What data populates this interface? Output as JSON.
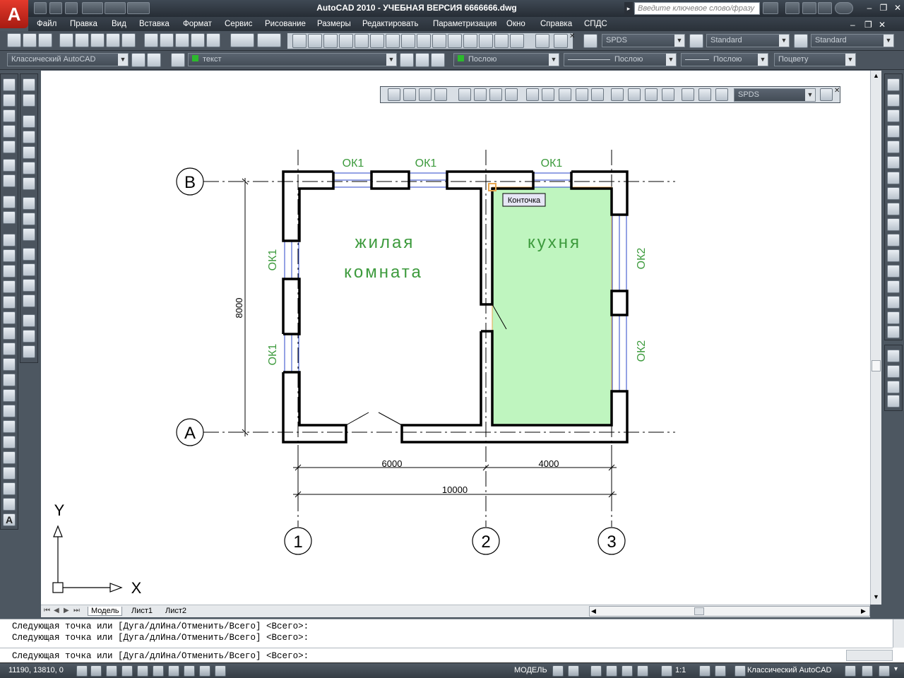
{
  "app": {
    "logo_letter": "A",
    "title": "AutoCAD 2010 - УЧЕБНАЯ ВЕРСИЯ     6666666.dwg",
    "search_placeholder": "Введите ключевое слово/фразу"
  },
  "menu": [
    "Файл",
    "Правка",
    "Вид",
    "Вставка",
    "Формат",
    "Сервис",
    "Рисование",
    "Размеры",
    "Редактировать",
    "Параметризация",
    "Окно",
    "Справка",
    "СПДС"
  ],
  "toolbars": {
    "workspace": "Классический AutoCAD",
    "layer": "текст",
    "color": "Послою",
    "linetype": "Послою",
    "lineweight": "Послою",
    "plotstyle": "Поцвету",
    "spds_style": "SPDS",
    "text_style": "Standard",
    "dim_style": "Standard",
    "floating_style": "SPDS"
  },
  "drawing": {
    "axes_rows": [
      "В",
      "А"
    ],
    "axes_cols": [
      "1",
      "2",
      "3"
    ],
    "windows": [
      "ОК1",
      "ОК1",
      "ОК1",
      "ОК1",
      "ОК1",
      "ОК2",
      "ОК2"
    ],
    "room1_line1": "жилая",
    "room1_line2": "комната",
    "room2": "кухня",
    "dim_left": "8000",
    "dim_6000": "6000",
    "dim_4000": "4000",
    "dim_total": "10000",
    "tooltip": "Конточка",
    "ucs_x": "X",
    "ucs_y": "Y"
  },
  "tabs": [
    "Модель",
    "Лист1",
    "Лист2"
  ],
  "command": {
    "line1": "Следующая точка или [Дуга/длИна/Отменить/Всего] <Всего>:",
    "line2": "Следующая точка или [Дуга/длИна/Отменить/Всего] <Всего>:",
    "line3": "Следующая точка или [Дуга/длИна/Отменить/Всего] <Всего>:"
  },
  "status": {
    "coords": "11190, 13810, 0",
    "model": "МОДЕЛЬ",
    "scale": "1:1",
    "workspace": "Классический AutoCAD"
  },
  "colors": {
    "accent_green": "#3c9a3c",
    "hatch": "#bff5bf",
    "window_blue": "#2a46c8"
  }
}
